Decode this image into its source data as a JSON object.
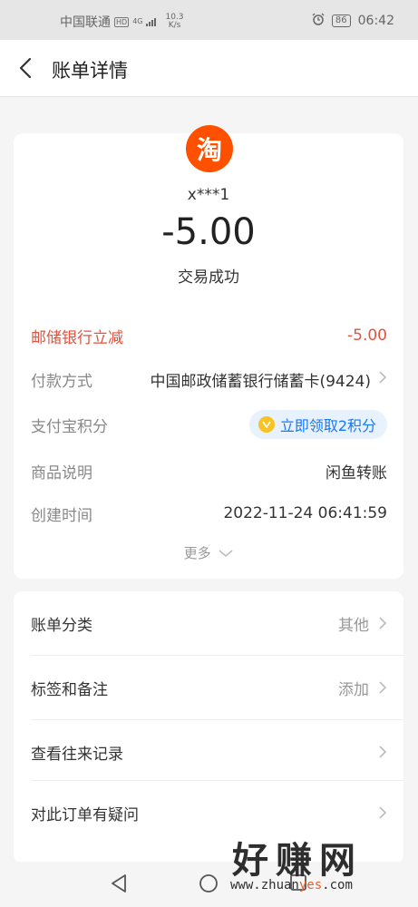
{
  "status_bar": {
    "carrier": "中国联通",
    "hd_badge": "HD",
    "network": "4G",
    "speed_value": "10.3",
    "speed_unit": "K/s",
    "battery": "86",
    "time": "06:42"
  },
  "nav": {
    "title": "账单详情"
  },
  "summary": {
    "merchant_logo_text": "淘",
    "merchant": "x***1",
    "amount": "-5.00",
    "status": "交易成功"
  },
  "details": [
    {
      "label": "邮储银行立减",
      "value": "-5.00"
    },
    {
      "label": "付款方式",
      "value": "中国邮政储蓄银行储蓄卡(9424)"
    },
    {
      "label": "支付宝积分",
      "value": "立即领取2积分"
    },
    {
      "label": "商品说明",
      "value": "闲鱼转账"
    },
    {
      "label": "创建时间",
      "value": "2022-11-24 06:41:59"
    }
  ],
  "more_label": "更多",
  "actions": [
    {
      "label": "账单分类",
      "value": "其他"
    },
    {
      "label": "标签和备注",
      "value": "添加"
    },
    {
      "label": "查看往来记录",
      "value": ""
    },
    {
      "label": "对此订单有疑问",
      "value": ""
    }
  ],
  "watermark": {
    "brand": "好赚网",
    "site_prefix": "www.zhuan",
    "site_highlight": "yes",
    "site_suffix": ".com"
  },
  "colors": {
    "accent_red": "#e0533e",
    "taobao_orange": "#ff5000",
    "points_blue": "#1677ff"
  }
}
